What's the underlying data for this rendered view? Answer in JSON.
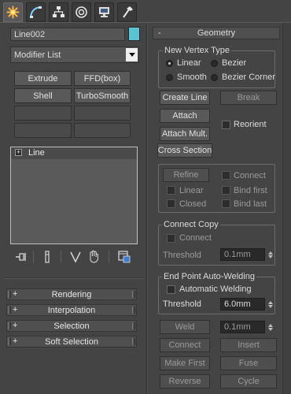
{
  "tabs": [
    {
      "name": "create-tab",
      "icon": "create-icon",
      "active": true
    },
    {
      "name": "modify-tab",
      "icon": "modify-curve-icon",
      "active": false
    },
    {
      "name": "hierarchy-tab",
      "icon": "hierarchy-icon",
      "active": false
    },
    {
      "name": "motion-tab",
      "icon": "motion-icon",
      "active": false
    },
    {
      "name": "display-tab",
      "icon": "display-monitor-icon",
      "active": false
    },
    {
      "name": "utilities-tab",
      "icon": "hammer-icon",
      "active": false
    }
  ],
  "object": {
    "name": "Line002",
    "color": "#5bc4d4"
  },
  "modifier_list": {
    "label": "Modifier List"
  },
  "modifier_buttons": [
    "Extrude",
    "FFD(box)",
    "Shell",
    "TurboSmooth"
  ],
  "stack": {
    "items": [
      {
        "label": "Line",
        "toggle": "+"
      }
    ]
  },
  "left_rollouts": [
    {
      "label": "Rendering",
      "toggle": "+"
    },
    {
      "label": "Interpolation",
      "toggle": "+"
    },
    {
      "label": "Selection",
      "toggle": "+"
    },
    {
      "label": "Soft Selection",
      "toggle": "+"
    }
  ],
  "geometry": {
    "title": "Geometry",
    "toggle": "-",
    "new_vertex_type": {
      "label": "New Vertex Type",
      "options": [
        "Linear",
        "Bezier",
        "Smooth",
        "Bezier Corner"
      ],
      "selected": "Linear"
    },
    "create_line": "Create Line",
    "break": "Break",
    "attach": "Attach",
    "attach_mult": "Attach Mult.",
    "reorient": "Reorient",
    "cross_section": "Cross Section",
    "refine": "Refine",
    "connect_chk": "Connect",
    "linear": "Linear",
    "bind_first": "Bind first",
    "closed": "Closed",
    "bind_last": "Bind last",
    "connect_copy": {
      "label": "Connect Copy",
      "connect": "Connect",
      "threshold_label": "Threshold",
      "threshold_value": "0.1mm"
    },
    "auto_weld": {
      "label": "End Point Auto-Welding",
      "automatic": "Automatic Welding",
      "threshold_label": "Threshold",
      "threshold_value": "6.0mm"
    },
    "weld": "Weld",
    "weld_value": "0.1mm",
    "connect_btn": "Connect",
    "insert": "Insert",
    "make_first": "Make First",
    "fuse": "Fuse",
    "reverse": "Reverse",
    "cycle": "Cycle"
  }
}
